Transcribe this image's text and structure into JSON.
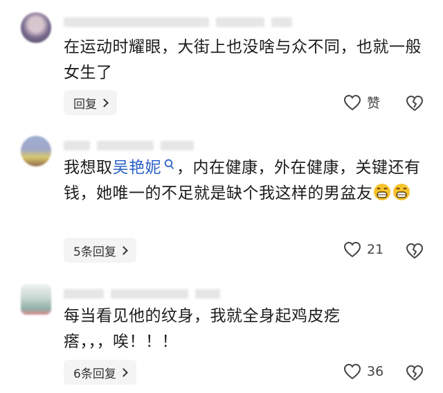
{
  "comments": [
    {
      "text": "在运动时耀眼，大街上也没啥与众不同，也就一般女生了",
      "replies_label": "回复",
      "like_label": "赞"
    },
    {
      "text_before": "我想取",
      "mention": "吴艳妮",
      "text_after": "，内在健康，外在健康，关键还有钱，她唯一的不足就是缺个我这样的男盆友",
      "emojis": [
        "grin-emoji",
        "grin-emoji"
      ],
      "replies_label": "5条回复",
      "like_count": "21"
    },
    {
      "text": "每当看见他的纹身，我就全身起鸡皮疙瘩，，，唉！！！",
      "replies_label": "6条回复",
      "like_count": "36"
    }
  ],
  "icons": {
    "like": "heart-outline-icon",
    "dislike": "broken-heart-icon",
    "mention": "search-icon",
    "chevron": "chevron-right-icon"
  },
  "colors": {
    "text": "#1c1c1c",
    "mention": "#2b62c7",
    "pill_bg": "#f4f4f4"
  }
}
